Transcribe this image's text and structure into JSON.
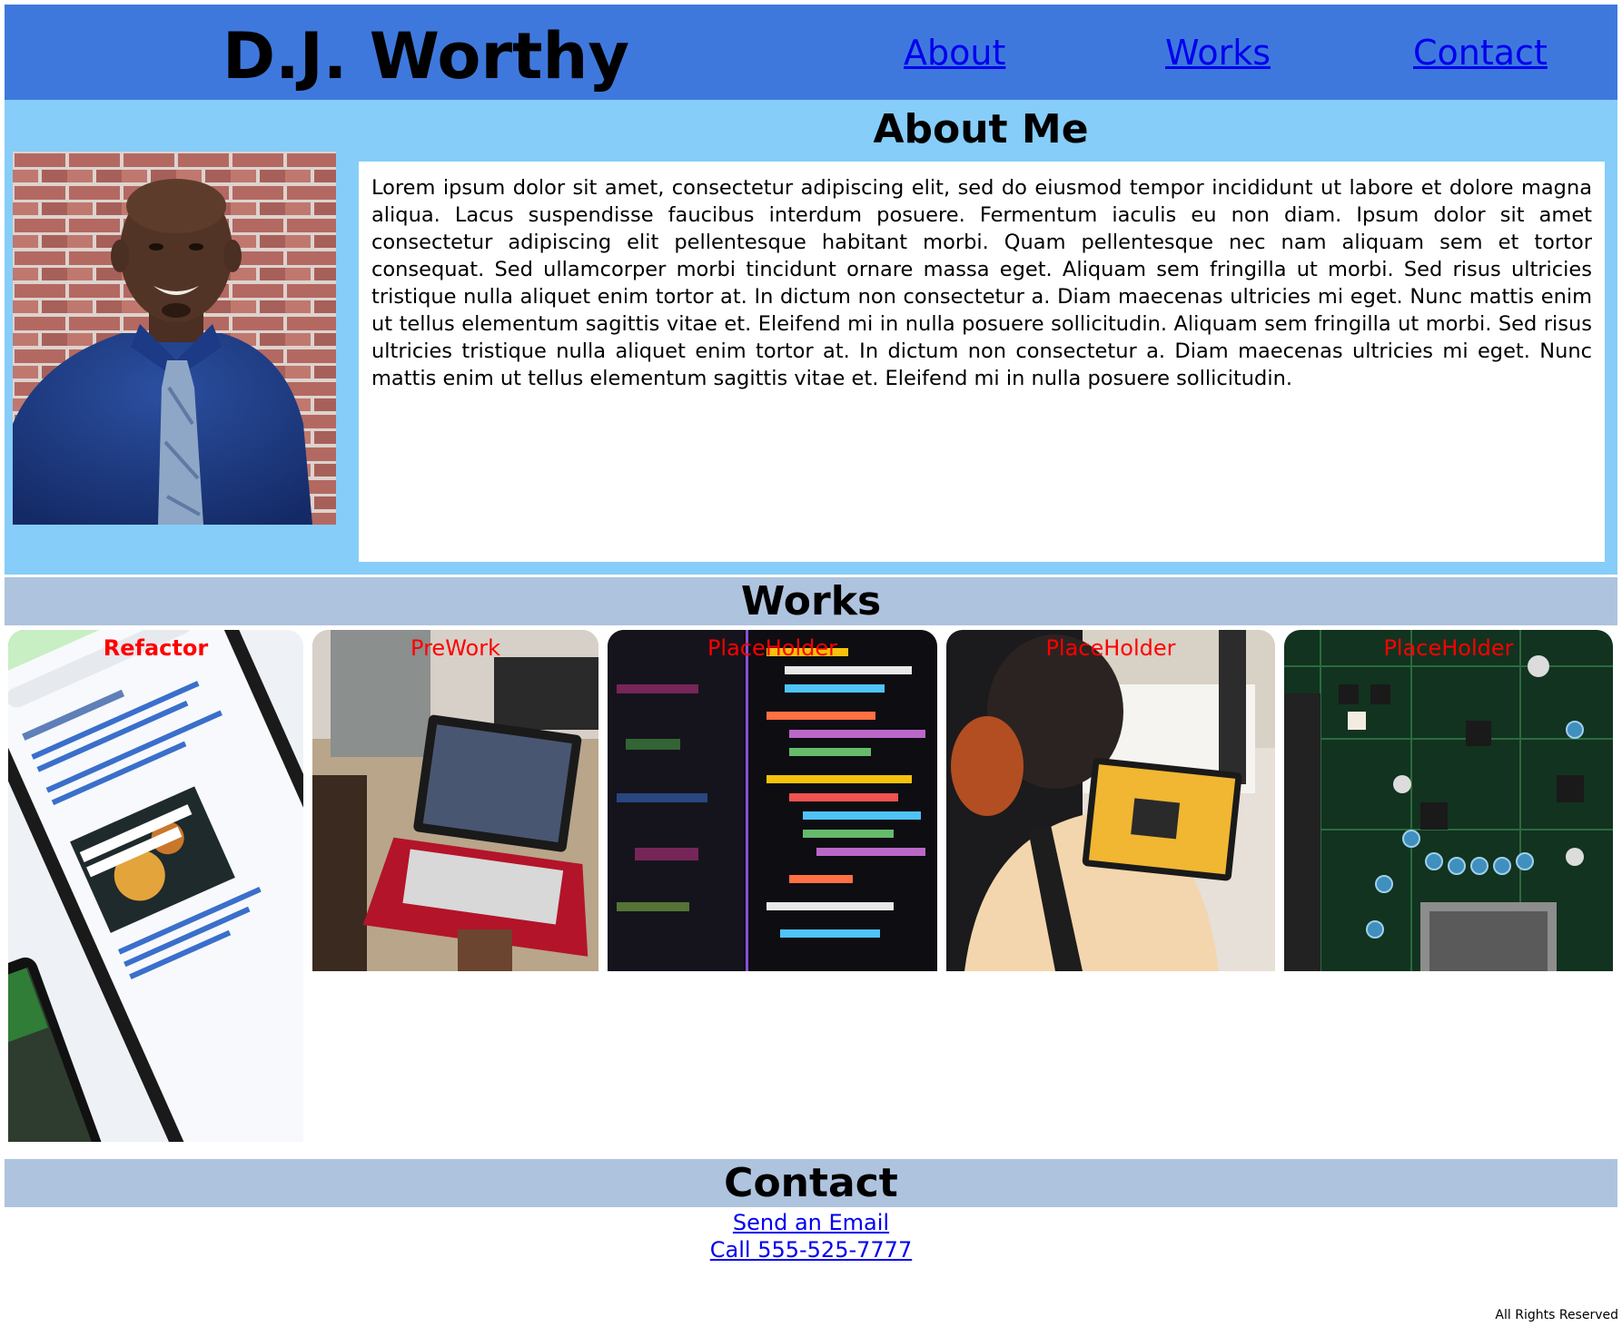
{
  "header": {
    "title": "D.J. Worthy",
    "nav": [
      {
        "label": "About"
      },
      {
        "label": "Works"
      },
      {
        "label": "Contact"
      }
    ]
  },
  "about": {
    "title": "About Me",
    "text": "Lorem ipsum dolor sit amet, consectetur adipiscing elit, sed do eiusmod tempor incididunt ut labore et dolore magna aliqua. Lacus suspendisse faucibus interdum posuere. Fermentum iaculis eu non diam. Ipsum dolor sit amet consectetur adipiscing elit pellentesque habitant morbi. Quam pellentesque nec nam aliquam sem et tortor consequat. Sed ullamcorper morbi tincidunt ornare massa eget. Aliquam sem fringilla ut morbi. Sed risus ultricies tristique nulla aliquet enim tortor at. In dictum non consectetur a. Diam maecenas ultricies mi eget. Nunc mattis enim ut tellus elementum sagittis vitae et. Eleifend mi in nulla posuere sollicitudin. Aliquam sem fringilla ut morbi. Sed risus ultricies tristique nulla aliquet enim tortor at. In dictum non consectetur a. Diam maecenas ultricies mi eget. Nunc mattis enim ut tellus elementum sagittis vitae et. Eleifend mi in nulla posuere sollicitudin."
  },
  "works": {
    "title": "Works",
    "cards": [
      {
        "label": "Refactor"
      },
      {
        "label": "PreWork"
      },
      {
        "label": "PlaceHolder"
      },
      {
        "label": "PlaceHolder"
      },
      {
        "label": "PlaceHolder"
      }
    ]
  },
  "contact": {
    "title": "Contact",
    "email_label": "Send an Email",
    "phone_label": "Call 555-525-7777"
  },
  "footer": {
    "text": "All Rights Reserved"
  },
  "colors": {
    "header_bg": "#3f78dd",
    "about_bg": "#86cdf9",
    "section_bar_bg": "#aec3de",
    "card_label": "#ff0000",
    "link": "#0000ee"
  }
}
